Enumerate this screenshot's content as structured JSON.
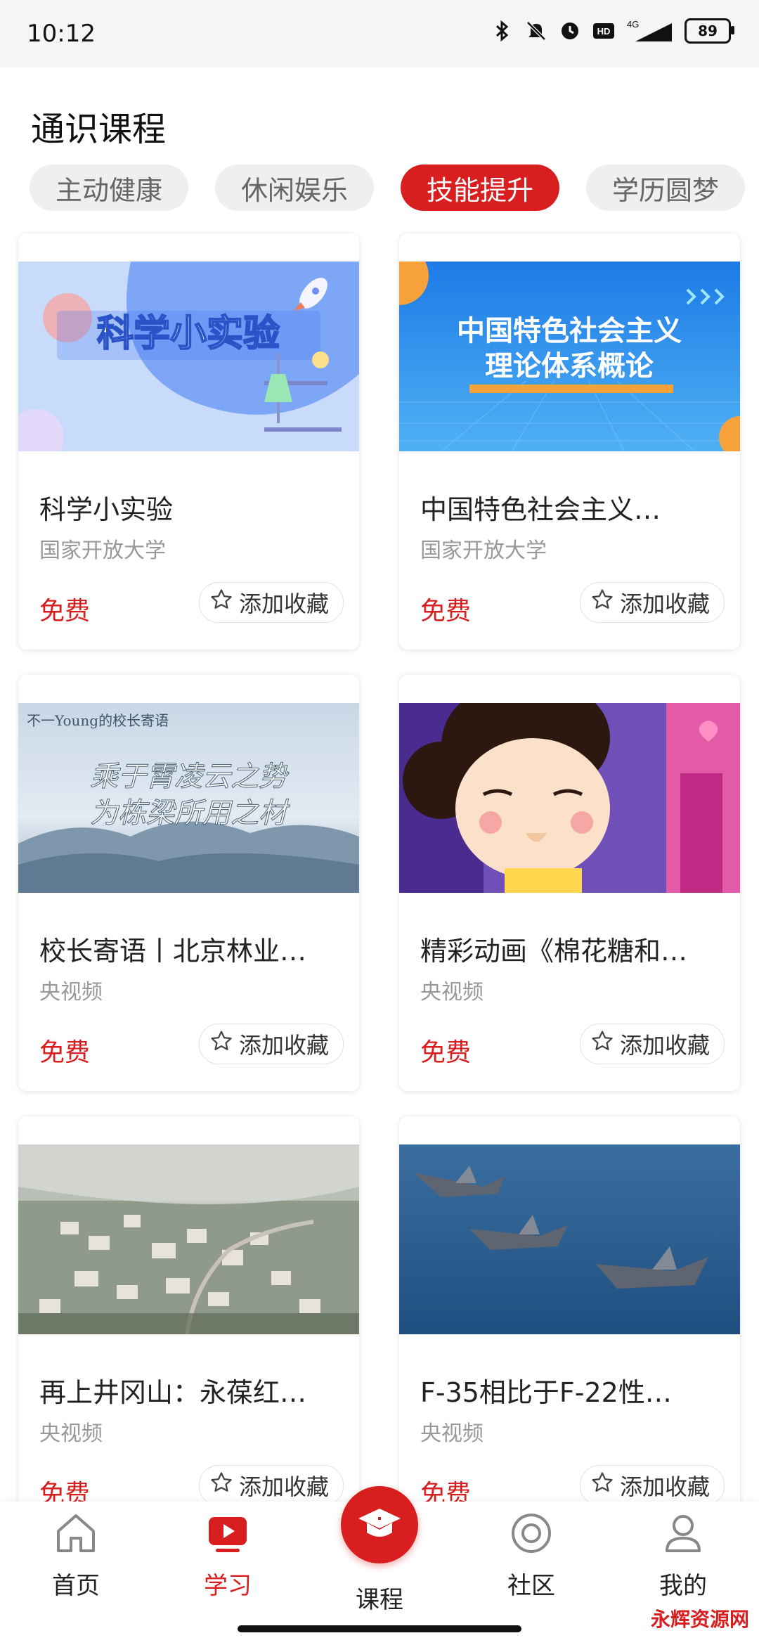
{
  "status_bar": {
    "time": "10:12",
    "network": "4G",
    "battery": "89",
    "hd": "HD"
  },
  "page": {
    "title": "通识课程"
  },
  "tabs": [
    {
      "label": "主动健康",
      "active": false
    },
    {
      "label": "休闲娱乐",
      "active": false
    },
    {
      "label": "技能提升",
      "active": true
    },
    {
      "label": "学历圆梦",
      "active": false
    }
  ],
  "cards": [
    {
      "title": "科学小实验",
      "source": "国家开放大学",
      "price": "免费",
      "fav_label": "添加收藏",
      "thumb_text": "科学小实验"
    },
    {
      "title": "中国特色社会主义…",
      "source": "国家开放大学",
      "price": "免费",
      "fav_label": "添加收藏",
      "thumb_text_line1": "中国特色社会主义",
      "thumb_text_line2": "理论体系概论"
    },
    {
      "title": "校长寄语丨北京林业…",
      "source": "央视频",
      "price": "免费",
      "fav_label": "添加收藏",
      "thumb_badge": "不一Young的校长寄语",
      "thumb_text_line1": "乘于霄凌云之势",
      "thumb_text_line2": "为栋梁所用之材"
    },
    {
      "title": "精彩动画《棉花糖和…",
      "source": "央视频",
      "price": "免费",
      "fav_label": "添加收藏"
    },
    {
      "title": "再上井冈山：永葆红…",
      "source": "央视频",
      "price": "免费",
      "fav_label": "添加收藏"
    },
    {
      "title": "F-35相比于F-22性…",
      "source": "央视频",
      "price": "免费",
      "fav_label": "添加收藏"
    }
  ],
  "bottom_nav": [
    {
      "label": "首页",
      "icon": "home-icon",
      "active": false
    },
    {
      "label": "学习",
      "icon": "play-icon",
      "active": true
    },
    {
      "label": "课程",
      "icon": "graduation-cap-icon",
      "active": false
    },
    {
      "label": "社区",
      "icon": "community-icon",
      "active": false
    },
    {
      "label": "我的",
      "icon": "user-icon",
      "active": false
    }
  ],
  "watermark": "永辉资源网",
  "colors": {
    "accent": "#d81e1e"
  }
}
